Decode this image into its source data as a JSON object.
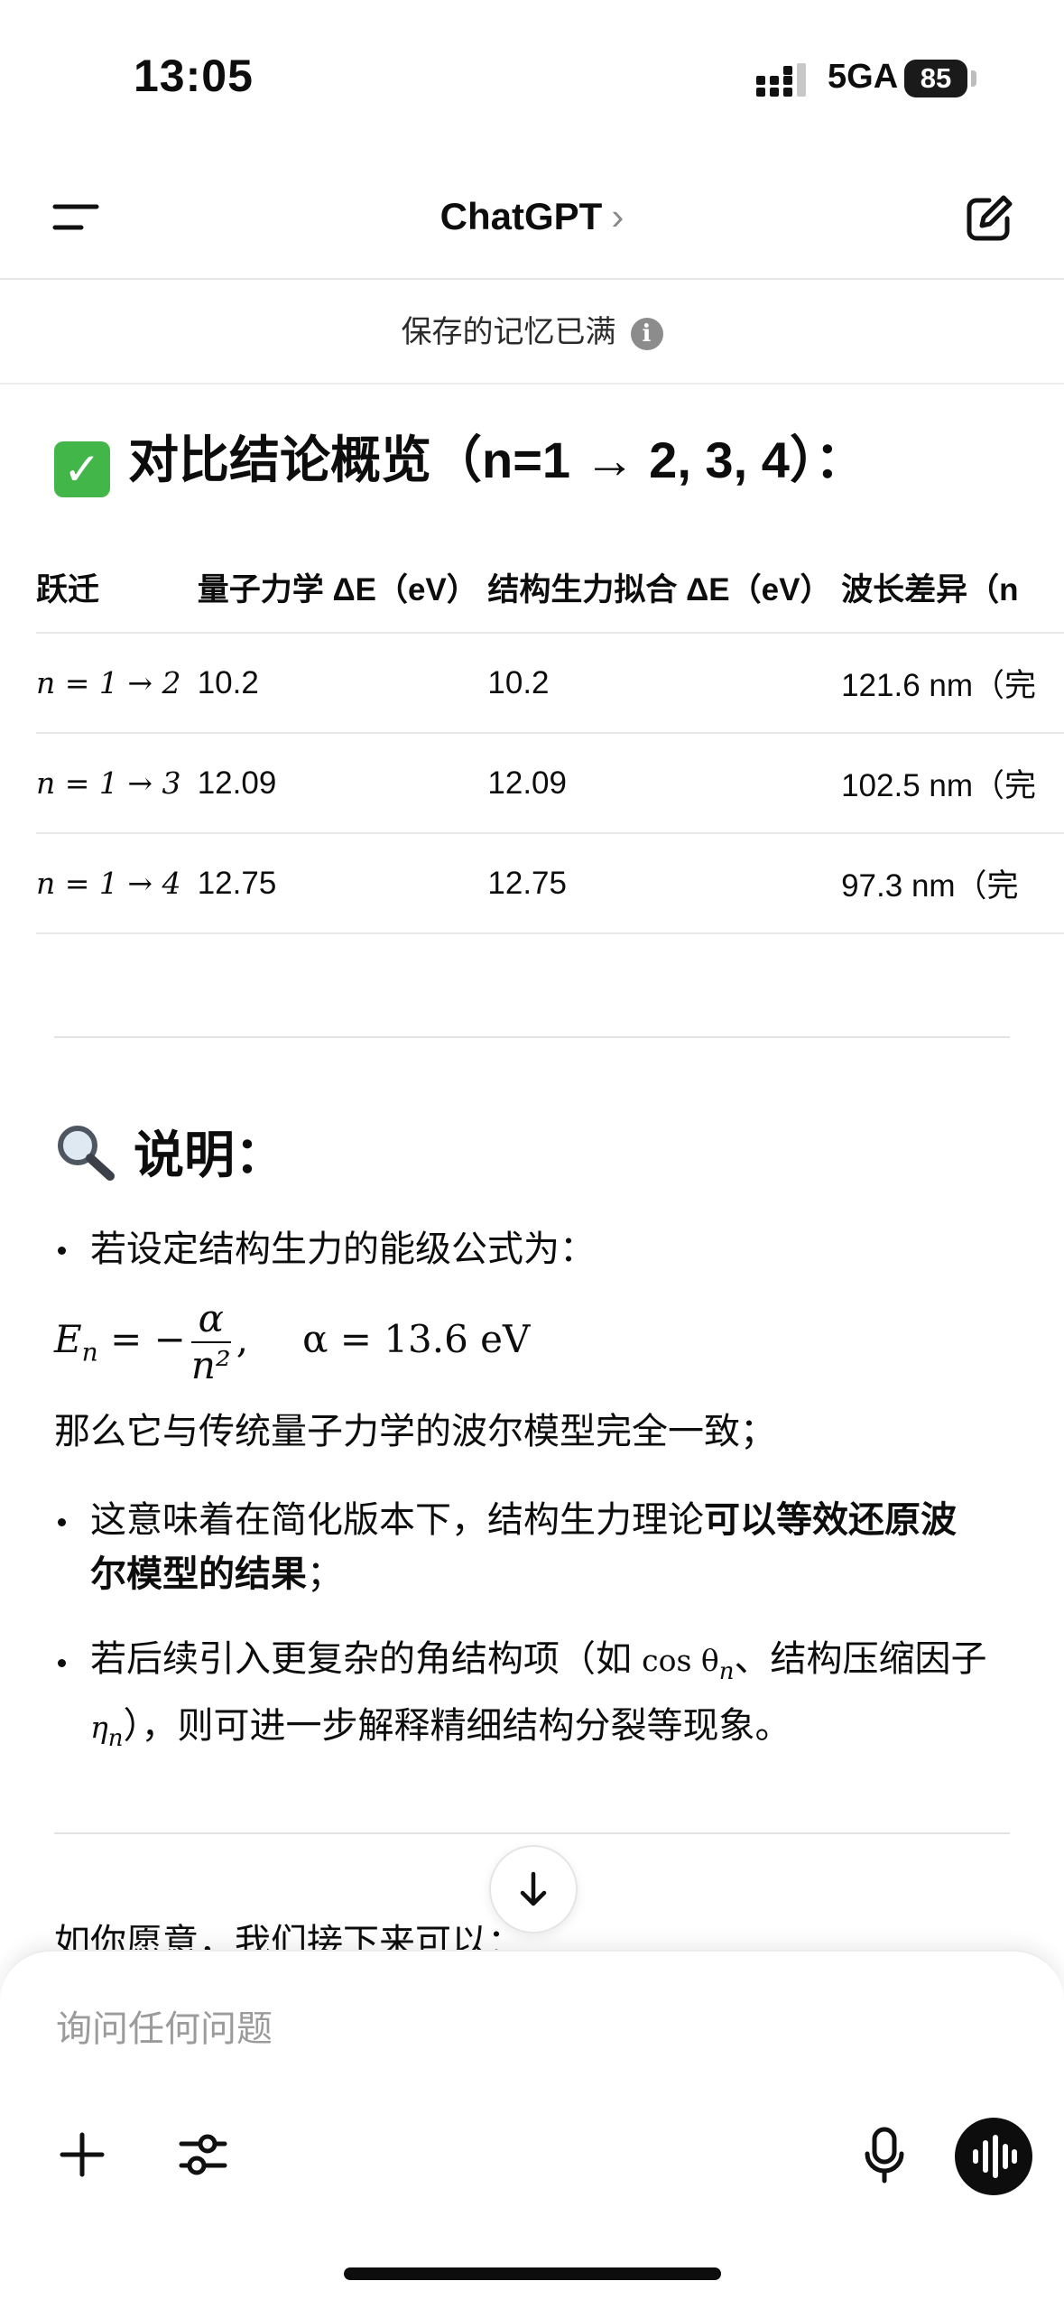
{
  "status_bar": {
    "time": "13:05",
    "network": "5GA",
    "battery": "85"
  },
  "nav": {
    "title": "ChatGPT",
    "chevron": "›",
    "menu_icon": "menu-icon",
    "new_chat_icon": "new-chat-icon"
  },
  "banner": {
    "text": "保存的记忆已满",
    "info": "i"
  },
  "section1": {
    "heading": "对比结论概览（n=1 → 2, 3, 4）："
  },
  "table": {
    "headers": [
      "跃迁",
      "量子力学 ΔE（eV）",
      "结构生力拟合 ΔE（eV）",
      "波长差异（n"
    ],
    "rows": [
      {
        "transition": "n = 1 → 2",
        "qm": "10.2",
        "fit": "10.2",
        "wavelength": "121.6 nm（完"
      },
      {
        "transition": "n = 1 → 3",
        "qm": "12.09",
        "fit": "12.09",
        "wavelength": "102.5 nm（完"
      },
      {
        "transition": "n = 1 → 4",
        "qm": "12.75",
        "fit": "12.75",
        "wavelength": "97.3 nm（完"
      }
    ]
  },
  "section2": {
    "heading": "说明：",
    "bullet1": "若设定结构生力的能级公式为：",
    "formula": {
      "lhs": "E",
      "sub": "n",
      "eq": " = −",
      "num": "α",
      "den": "n²",
      "comma": ",",
      "rhs": "α = 13.6 eV"
    },
    "line_after_formula": "那么它与传统量子力学的波尔模型完全一致；",
    "bullet2_plain": "这意味着在简化版本下，结构生力理论",
    "bullet2_bold_a": "可以等效还原波",
    "bullet2_bold_b": "尔模型的结果",
    "bullet2_end": "；",
    "bullet3_a": "若后续引入更复杂的角结构项（如 ",
    "bullet3_math1": "cos θ",
    "bullet3_math1_sub": "n",
    "bullet3_b": "、结构压缩因子",
    "bullet3_math2": "η",
    "bullet3_math2_sub": "n",
    "bullet3_c": "），则可进一步解释精细结构分裂等现象。"
  },
  "partial_line": "如你愿意，我们接下来可以：",
  "composer": {
    "placeholder": "询问任何问题"
  }
}
